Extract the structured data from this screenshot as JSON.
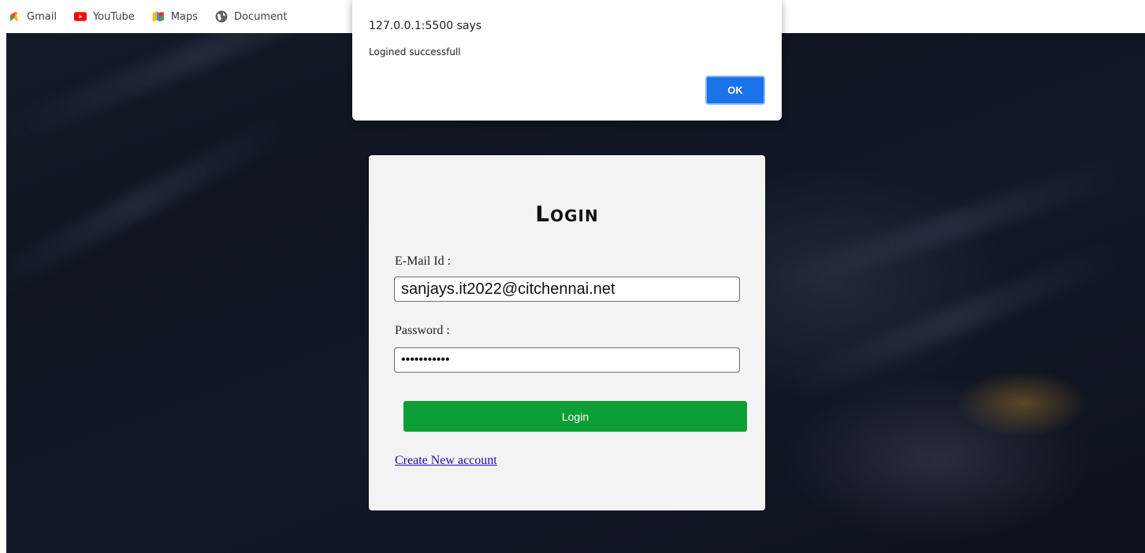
{
  "bookmarks": [
    {
      "label": "Gmail",
      "icon": "gmail-icon"
    },
    {
      "label": "YouTube",
      "icon": "youtube-icon"
    },
    {
      "label": "Maps",
      "icon": "maps-icon"
    },
    {
      "label": "Document",
      "icon": "globe-icon"
    }
  ],
  "dialog": {
    "title": "127.0.0.1:5500 says",
    "message": "Logined successfull",
    "ok_label": "OK"
  },
  "login": {
    "title": "Login",
    "email_label": "E-Mail Id :",
    "email_value": "sanjays.it2022@citchennai.net",
    "password_label": "Password :",
    "password_value": "•••••••••••",
    "button_label": "Login",
    "create_link": "Create New account"
  },
  "colors": {
    "login_button": "#0e9e36",
    "ok_button": "#1a73e8",
    "link": "#1a0dab"
  }
}
